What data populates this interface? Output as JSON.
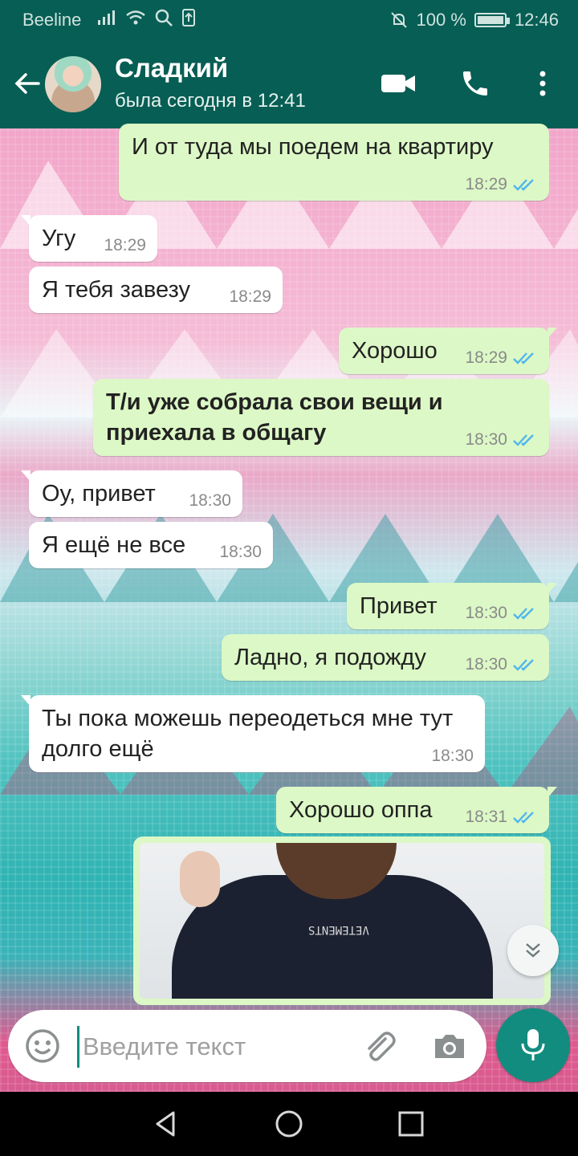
{
  "status_bar": {
    "carrier": "Beeline",
    "battery": "100 %",
    "time": "12:46"
  },
  "header": {
    "contact_name": "Сладкий",
    "last_seen": "была сегодня в 12:41"
  },
  "messages": [
    {
      "dir": "out",
      "text": "И от туда мы поедем на квартиру",
      "time": "18:29"
    },
    {
      "dir": "in",
      "text": "Угу",
      "time": "18:29"
    },
    {
      "dir": "in",
      "text": "Я тебя завезу",
      "time": "18:29"
    },
    {
      "dir": "out",
      "text": "Хорошо",
      "time": "18:29"
    },
    {
      "dir": "out",
      "text": "Т/и уже собрала свои вещи и приехала в общагу",
      "time": "18:30"
    },
    {
      "dir": "in",
      "text": "Оу, привет",
      "time": "18:30"
    },
    {
      "dir": "in",
      "text": "Я ещё не все",
      "time": "18:30"
    },
    {
      "dir": "out",
      "text": "Привет",
      "time": "18:30"
    },
    {
      "dir": "out",
      "text": "Ладно, я подожду",
      "time": "18:30"
    },
    {
      "dir": "in",
      "text": "Ты пока можешь переодеться мне тут долго ещё",
      "time": "18:30"
    },
    {
      "dir": "out",
      "text": "Хорошо оппа",
      "time": "18:31"
    }
  ],
  "image_message": {
    "logo_text": "VETEMENTS"
  },
  "composer": {
    "placeholder": "Введите текст"
  },
  "colors": {
    "header": "#075e54",
    "outgoing_bubble": "#dcf8c6",
    "incoming_bubble": "#ffffff",
    "accent": "#128c7e",
    "read_ticks": "#4fb6ec"
  }
}
